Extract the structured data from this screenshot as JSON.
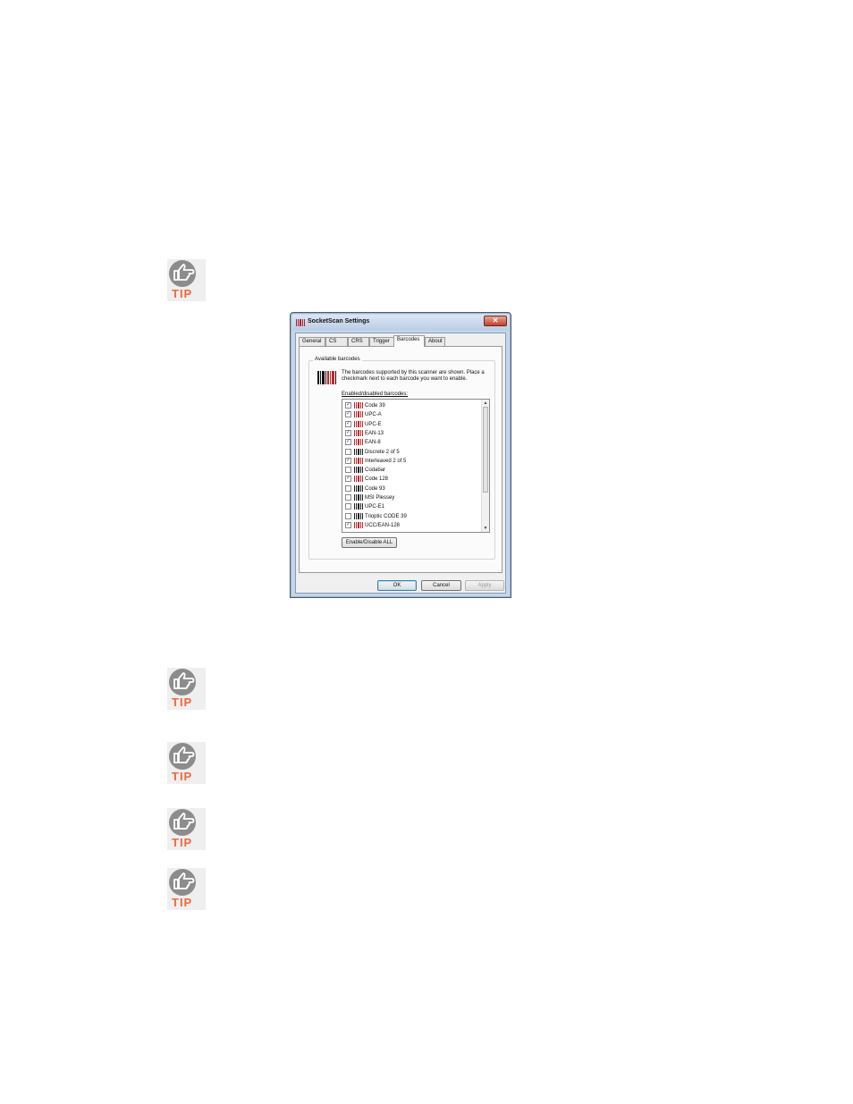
{
  "tip_label": "TIP",
  "dialog": {
    "title": "SocketScan Settings",
    "close_glyph": "✕",
    "tabs": [
      {
        "label": "General"
      },
      {
        "label": "CS"
      },
      {
        "label": "CRS"
      },
      {
        "label": "Trigger"
      },
      {
        "label": "Barcodes"
      },
      {
        "label": "About"
      }
    ],
    "active_tab": "Barcodes",
    "group_title": "Available barcodes",
    "description": "The barcodes supported by this scanner are shown. Place a checkmark next to each barcode you want to enable.",
    "list_label": "Enabled/disabled barcodes:",
    "barcodes": [
      {
        "label": "Code 39",
        "checked": true,
        "icon": "barcode-enabled-icon"
      },
      {
        "label": "UPC-A",
        "checked": true,
        "icon": "barcode-enabled-icon"
      },
      {
        "label": "UPC-E",
        "checked": true,
        "icon": "barcode-enabled-icon"
      },
      {
        "label": "EAN-13",
        "checked": true,
        "icon": "barcode-enabled-icon"
      },
      {
        "label": "EAN-8",
        "checked": true,
        "icon": "barcode-enabled-icon"
      },
      {
        "label": "Discrete 2 of 5",
        "checked": false,
        "icon": "barcode-disabled-icon"
      },
      {
        "label": "Interleaved 2 of 5",
        "checked": true,
        "icon": "barcode-enabled-icon"
      },
      {
        "label": "Codabar",
        "checked": false,
        "icon": "barcode-disabled-icon"
      },
      {
        "label": "Code 128",
        "checked": true,
        "icon": "barcode-enabled-icon"
      },
      {
        "label": "Code 93",
        "checked": false,
        "icon": "barcode-disabled-icon"
      },
      {
        "label": "MSI Plessey",
        "checked": false,
        "icon": "barcode-disabled-icon"
      },
      {
        "label": "UPC-E1",
        "checked": false,
        "icon": "barcode-disabled-icon"
      },
      {
        "label": "Trioptic CODE 39",
        "checked": false,
        "icon": "barcode-disabled-icon"
      },
      {
        "label": "UCC/EAN-128",
        "checked": true,
        "icon": "barcode-enabled-icon"
      }
    ],
    "enable_all_label": "Enable/Disable ALL",
    "ok_label": "OK",
    "cancel_label": "Cancel",
    "apply_label": "Apply"
  },
  "colors": {
    "tip_orange": "#f2683a",
    "barcode_red": "#c0272d",
    "check_blue": "#2b5aa8"
  }
}
